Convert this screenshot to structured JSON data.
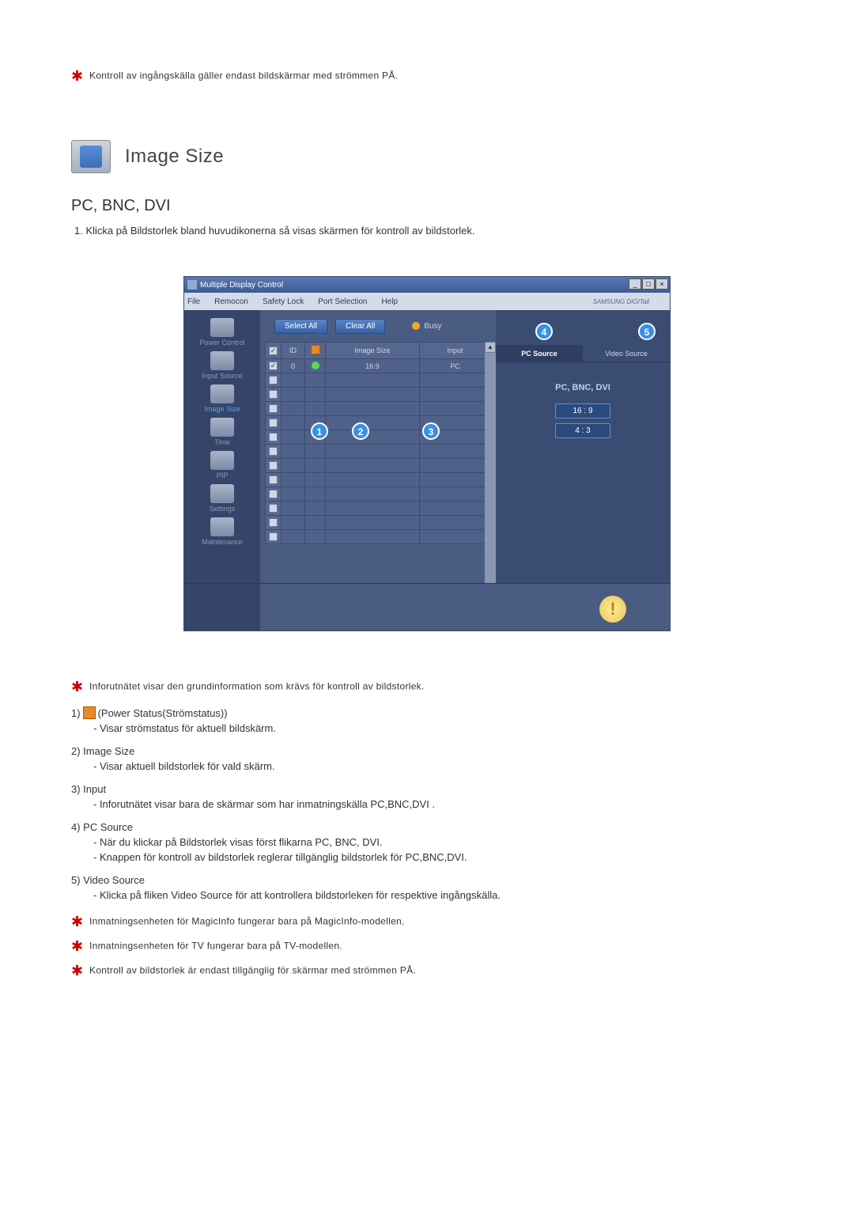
{
  "intro_note": "Kontroll av ingångskälla gäller endast bildskärmar med strömmen PÅ.",
  "section_title": "Image Size",
  "subheading": "PC, BNC, DVI",
  "step_1": "1.  Klicka på Bildstorlek bland huvudikonerna så visas skärmen för kontroll av bildstorlek.",
  "window": {
    "title": "Multiple Display Control",
    "brand": "SAMSUNG DIGITall",
    "menu": [
      "File",
      "Remocon",
      "Safety Lock",
      "Port Selection",
      "Help"
    ],
    "sidebar": [
      {
        "label": "Power Control"
      },
      {
        "label": "Input Source"
      },
      {
        "label": "Image Size",
        "active": true
      },
      {
        "label": "Time"
      },
      {
        "label": "PIP"
      },
      {
        "label": "Settings"
      },
      {
        "label": "Maintenance"
      }
    ],
    "buttons": {
      "select_all": "Select All",
      "clear_all": "Clear All",
      "busy": "Busy"
    },
    "table": {
      "headers": {
        "id": "ID",
        "image_size": "Image Size",
        "input": "Input"
      },
      "row": {
        "id": "0",
        "image_size": "16:9",
        "input": "PC"
      }
    },
    "right": {
      "tab_pc": "PC Source",
      "tab_video": "Video Source",
      "mode_label": "PC, BNC, DVI",
      "ratio_16_9": "16 : 9",
      "ratio_4_3": "4 : 3"
    },
    "callouts": {
      "c1": "1",
      "c2": "2",
      "c3": "3",
      "c4": "4",
      "c5": "5"
    }
  },
  "info_note": "Inforutnätet visar den grundinformation som krävs för kontroll av bildstorlek.",
  "items": {
    "i1_label": "1)",
    "i1_text": "(Power Status(Strömstatus))",
    "i1_sub": "- Visar strömstatus för aktuell bildskärm.",
    "i2_label": "2)  Image Size",
    "i2_sub": "- Visar aktuell bildstorlek för vald skärm.",
    "i3_label": "3)  Input",
    "i3_sub": "- Inforutnätet visar bara de skärmar som har inmatningskälla PC,BNC,DVI .",
    "i4_label": "4)  PC Source",
    "i4_sub1": "- När du klickar på Bildstorlek visas först flikarna PC, BNC, DVI.",
    "i4_sub2": "- Knappen för kontroll av bildstorlek reglerar tillgänglig bildstorlek för PC,BNC,DVI.",
    "i5_label": "5)  Video Source",
    "i5_sub": "- Klicka på fliken Video Source för att kontrollera bildstorleken för respektive ingångskälla."
  },
  "end_notes": {
    "n1": "Inmatningsenheten för MagicInfo fungerar bara på MagicInfo-modellen.",
    "n2": "Inmatningsenheten för TV fungerar bara på TV-modellen.",
    "n3": "Kontroll av bildstorlek är endast tillgänglig för skärmar med strömmen PÅ."
  }
}
